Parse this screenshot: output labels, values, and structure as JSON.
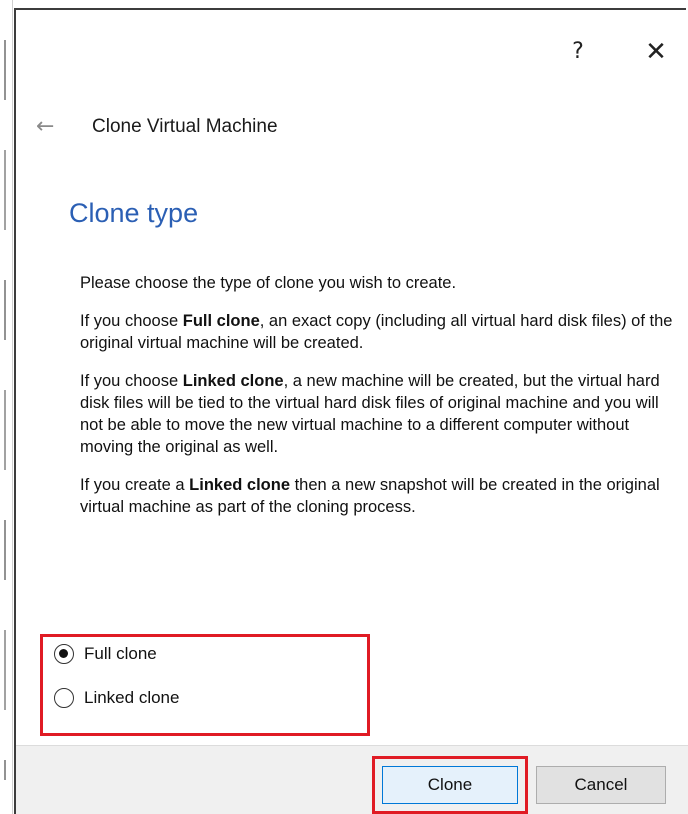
{
  "window": {
    "help_icon": "?",
    "close_icon": "✕",
    "back_icon": "←",
    "title": "Clone Virtual Machine"
  },
  "page": {
    "heading": "Clone type",
    "intro": "Please choose the type of clone you wish to create.",
    "full_clone_p": {
      "pre": "If you choose ",
      "bold": "Full clone",
      "post": ", an exact copy (including all virtual hard disk files) of the original virtual machine will be created."
    },
    "linked_clone_p": {
      "pre": "If you choose ",
      "bold": "Linked clone",
      "post": ", a new machine will be created, but the virtual hard disk files will be tied to the virtual hard disk files of original machine and you will not be able to move the new virtual machine to a different computer without moving the original as well."
    },
    "snapshot_p": {
      "pre": "If you create a ",
      "bold": "Linked clone",
      "post": " then a new snapshot will be created in the original virtual machine as part of the cloning process."
    }
  },
  "options": {
    "selected": "Full clone",
    "items": [
      {
        "label": "Full clone",
        "checked": true
      },
      {
        "label": "Linked clone",
        "checked": false
      }
    ]
  },
  "buttons": {
    "clone_label": "Clone",
    "cancel_label": "Cancel"
  },
  "colors": {
    "heading": "#2b5fb4",
    "highlight": "#e01b24",
    "default_button_border": "#0078d7",
    "button_bar": "#f0f0f0"
  },
  "icons": {
    "help": "help-icon",
    "close": "close-icon",
    "back": "back-arrow-icon"
  }
}
